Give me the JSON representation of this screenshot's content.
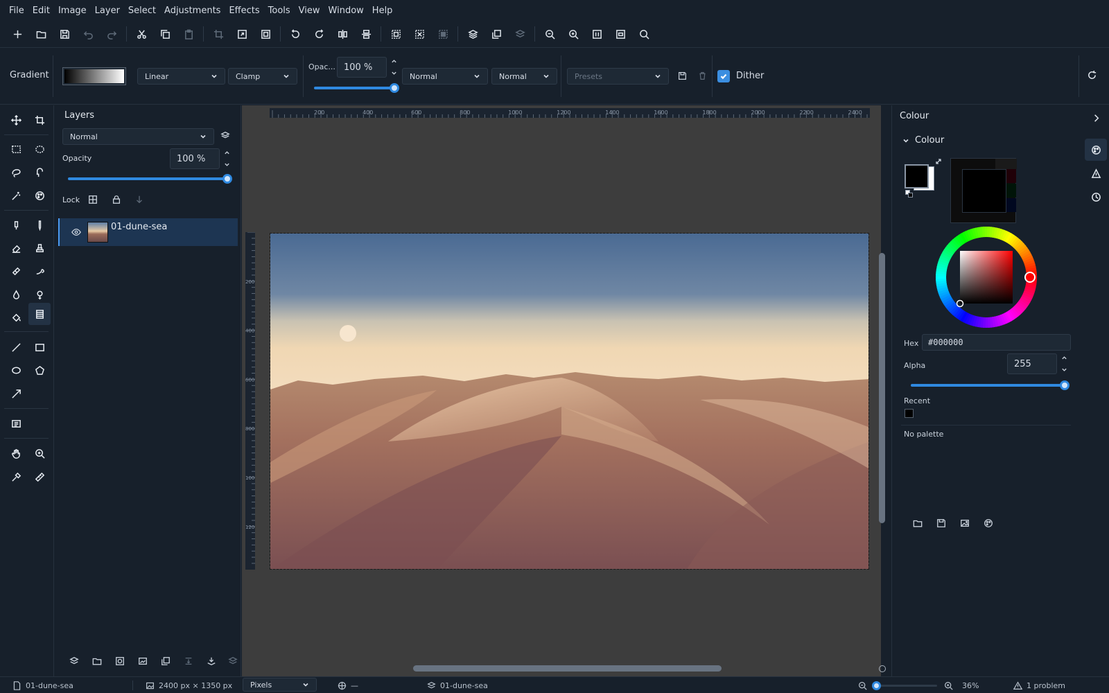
{
  "menubar": {
    "items": [
      "File",
      "Edit",
      "Image",
      "Layer",
      "Select",
      "Adjustments",
      "Effects",
      "Tools",
      "View",
      "Window",
      "Help"
    ]
  },
  "toolbar": {
    "icons": [
      "new-file-icon",
      "open-file-icon",
      "save-icon",
      "undo-icon",
      "redo-icon",
      "cut-icon",
      "copy-icon",
      "paste-icon",
      "crop-icon",
      "resize-image-icon",
      "resize-canvas-icon",
      "rotate-left-icon",
      "rotate-right-icon",
      "flip-horizontal-icon",
      "flip-vertical-icon",
      "select-all-icon",
      "deselect-icon",
      "invert-selection-icon",
      "add-layer-icon",
      "duplicate-layer-icon",
      "merge-layer-icon",
      "zoom-out-icon",
      "zoom-in-icon",
      "actual-size-icon",
      "fit-window-icon",
      "search-icon"
    ]
  },
  "tool_options": {
    "tool_name": "Gradient",
    "gradient_type": "Linear",
    "repeat_mode": "Clamp",
    "opacity_label": "Opac...",
    "opacity_value": "100 %",
    "opacity_fraction": 1.0,
    "blend_mode": "Normal",
    "alpha_mode": "Normal",
    "presets_placeholder": "Presets",
    "dither_label": "Dither",
    "dither_checked": true
  },
  "layers_panel": {
    "title": "Layers",
    "blend_mode": "Normal",
    "opacity_label": "Opacity",
    "opacity_value": "100 %",
    "opacity_fraction": 1.0,
    "lock_label": "Lock",
    "layers": [
      {
        "name": "01-dune-sea",
        "visible": true,
        "selected": true
      }
    ]
  },
  "canvas": {
    "hruler_labels": [
      "200",
      "400",
      "600",
      "800",
      "1000",
      "1200",
      "1400",
      "1600",
      "1800",
      "2000",
      "2200",
      "2400"
    ],
    "vruler_labels": [
      "200",
      "400",
      "600",
      "800",
      "1000",
      "1200"
    ]
  },
  "colour_panel": {
    "header": "Colour",
    "section_title": "Colour",
    "primary_color": "#000000",
    "secondary_color": "#ffffff",
    "hex_label": "Hex",
    "hex_value": "#000000",
    "alpha_label": "Alpha",
    "alpha_value": "255",
    "alpha_fraction": 1.0,
    "recent_label": "Recent",
    "recent_colors": [
      "#000000"
    ],
    "no_palette_label": "No palette"
  },
  "status_bar": {
    "document_name": "01-dune-sea",
    "image_size": "2400 px × 1350 px",
    "units": "Pixels",
    "cursor_position": "—",
    "current_layer": "01-dune-sea",
    "zoom_value": "36%",
    "problems": "1 problem"
  },
  "colors": {
    "accent": "#3b8ee0",
    "background": "#17202b",
    "canvas_bg": "#3d3d3d",
    "selected_layer": "#1d3552"
  }
}
